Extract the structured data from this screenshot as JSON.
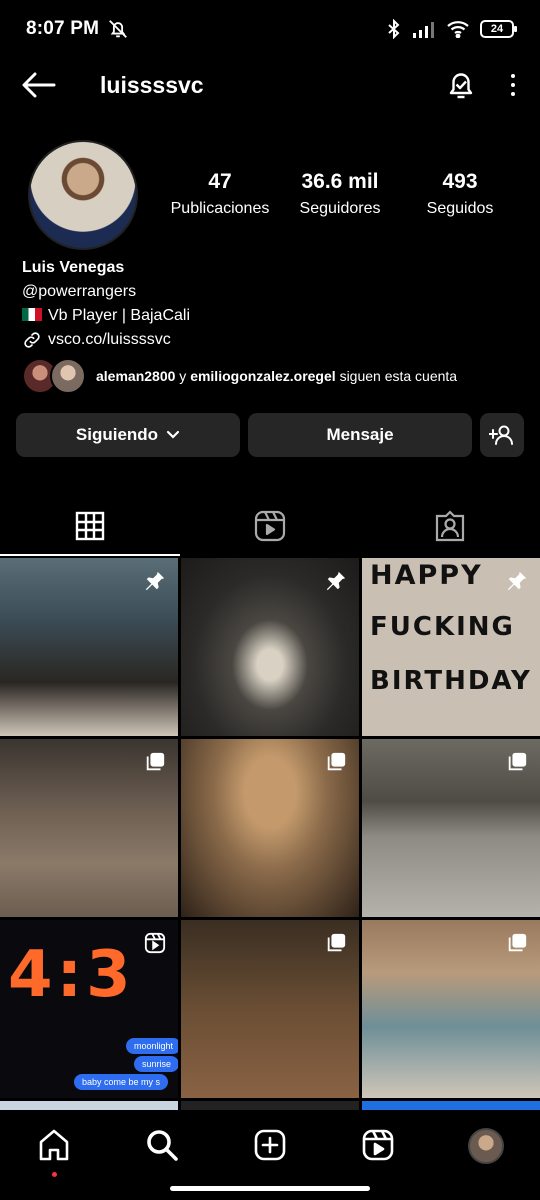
{
  "status": {
    "time": "8:07 PM",
    "battery": "24"
  },
  "header": {
    "username": "luissssvc"
  },
  "profile": {
    "stats": [
      {
        "num": "47",
        "label": "Publicaciones"
      },
      {
        "num": "36.6 mil",
        "label": "Seguidores"
      },
      {
        "num": "493",
        "label": "Seguidos"
      }
    ],
    "name": "Luis Venegas",
    "handle": "@powerrangers",
    "bio_line": "Vb Player | BajaCali",
    "link": "vsco.co/luissssvc",
    "mutual": {
      "user1": "aleman2800",
      "conj": "y",
      "user2": "emiliogonzalez.oregel",
      "suffix": "siguen esta cuenta"
    }
  },
  "actions": {
    "follow_label": "Siguiendo",
    "message_label": "Mensaje"
  },
  "grid": {
    "birthday_lines": [
      "HAPPY",
      "FUCKING",
      "BIRTHDAY"
    ],
    "clock_text": "4:3",
    "bubbles": [
      "moonlight",
      "sunrise",
      "baby come be my s"
    ]
  },
  "colors": {
    "background": "#000000",
    "button": "#262626",
    "accent_link": "#2f6df0",
    "notification_dot": "#ff3040"
  },
  "icons": [
    "back-arrow-icon",
    "bell-check-icon",
    "more-vertical-icon",
    "grid-icon",
    "reels-icon",
    "tagged-icon",
    "pin-icon",
    "carousel-icon",
    "reel-badge-icon",
    "home-icon",
    "search-icon",
    "create-icon",
    "reels-nav-icon",
    "profile-avatar"
  ]
}
